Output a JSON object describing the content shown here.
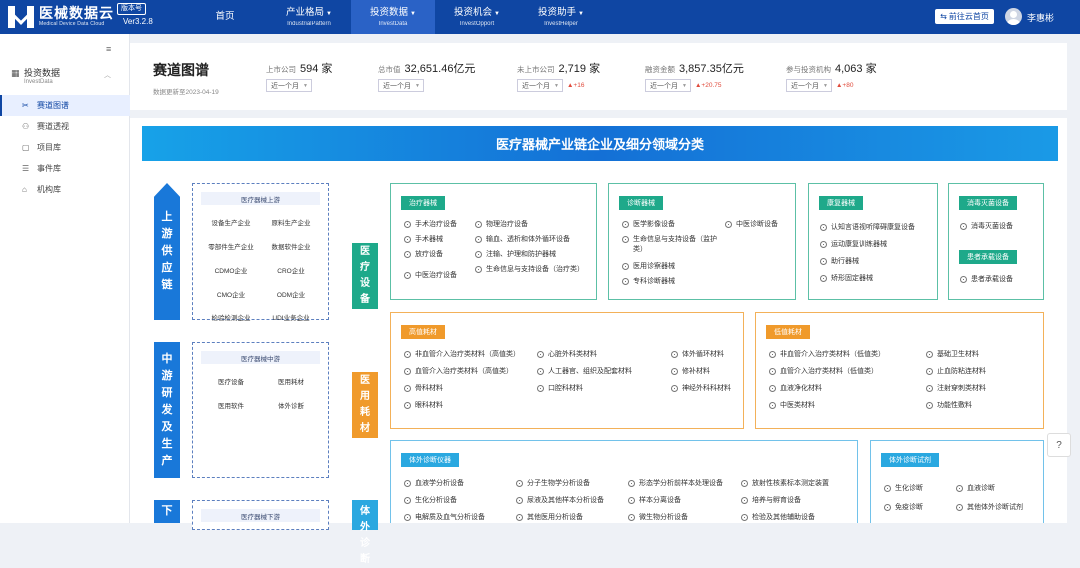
{
  "brand": {
    "name": "医械数据云",
    "sub": "Medical Device Data Cloud",
    "version_badge": "版本号",
    "version": "Ver3.2.8"
  },
  "nav": [
    {
      "label": "首页",
      "sub": ""
    },
    {
      "label": "产业格局",
      "sub": "IndustrialPattern"
    },
    {
      "label": "投资数据",
      "sub": "InvestData"
    },
    {
      "label": "投资机会",
      "sub": "InvestOpport"
    },
    {
      "label": "投资助手",
      "sub": "InvestHelper"
    }
  ],
  "header": {
    "goto_label": "前往云首页",
    "username": "李惠彬"
  },
  "sidebar": {
    "group": {
      "label": "投资数据",
      "sub": "InvestData"
    },
    "items": [
      {
        "label": "赛道图谱",
        "icon": "scissors-icon"
      },
      {
        "label": "赛道透视",
        "icon": "chart-icon"
      },
      {
        "label": "项目库",
        "icon": "file-icon"
      },
      {
        "label": "事件库",
        "icon": "event-icon"
      },
      {
        "label": "机构库",
        "icon": "building-icon"
      }
    ]
  },
  "stats": {
    "title": "赛道图谱",
    "update": "数据更新至2023-04-19",
    "items": [
      {
        "label": "上市公司",
        "value": "594 家",
        "period": "近一个月",
        "delta": ""
      },
      {
        "label": "总市值",
        "value": "32,651.46亿元",
        "period": "近一个月",
        "delta": ""
      },
      {
        "label": "未上市公司",
        "value": "2,719 家",
        "period": "近一个月",
        "delta": "▲+16"
      },
      {
        "label": "融资金额",
        "value": "3,857.35亿元",
        "period": "近一个月",
        "delta": "▲+20.75"
      },
      {
        "label": "参与投资机构",
        "value": "4,063 家",
        "period": "近一个月",
        "delta": "▲+80"
      }
    ]
  },
  "map": {
    "banner": "医疗器械产业链企业及细分领域分类",
    "chain": {
      "upstream": {
        "label": "上游供应链",
        "head": "医疗器械上游",
        "cells": [
          "设备生产企业",
          "原料生产企业",
          "零部件生产企业",
          "数据软件企业",
          "CDMO企业",
          "CRO企业",
          "CMO企业",
          "ODM企业",
          "检验检测企业",
          "UDI业务企业"
        ]
      },
      "midstream": {
        "label": "中游研发及生产",
        "head": "医疗器械中游",
        "cells": [
          "医疗设备",
          "医用耗材",
          "医用软件",
          "体外诊断"
        ]
      },
      "downstream": {
        "label": "下",
        "head": "医疗器械下游"
      }
    },
    "categories": {
      "equipment": "医疗设备",
      "consumables": "医用耗材",
      "ivd": "体外诊断"
    },
    "cards": {
      "treatment": {
        "tag": "治疗器械",
        "items": [
          "手术治疗设备",
          "手术器械",
          "放疗设备",
          "中医治疗设备",
          "物理治疗设备",
          "输血、透析和体外循环设备",
          "注输、护理和防护器械",
          "生命信息与支持设备（治疗类）"
        ]
      },
      "diagnosis": {
        "tag": "诊断器械",
        "items": [
          "医学影像设备",
          "生命信息与支持设备（监护类）",
          "医用诊察器械",
          "专科诊断器械",
          "中医诊断设备"
        ]
      },
      "rehab": {
        "tag": "康复器械",
        "items": [
          "认知言语视听障碍康复设备",
          "运动康复训练器械",
          "助行器械",
          "矫形固定器械"
        ]
      },
      "disinfect": {
        "tag": "消毒灭菌设备",
        "items": [
          "消毒灭菌设备"
        ]
      },
      "patient": {
        "tag": "患者承载设备",
        "items": [
          "患者承载设备"
        ]
      },
      "highvalue": {
        "tag": "高值耗材",
        "items": [
          "非血管介入治疗类材料（高值类）",
          "血管介入治疗类材料（高值类）",
          "骨科材料",
          "眼科材料",
          "心脏外科类材料",
          "人工器官、组织及配套材料",
          "口腔科材料",
          "体外循环材料",
          "修补材料",
          "神经外科科材料"
        ]
      },
      "lowvalue": {
        "tag": "低值耗材",
        "items": [
          "非血管介入治疗类材料（低值类）",
          "血管介入治疗类材料（低值类）",
          "血液净化材料",
          "中医类材料",
          "基础卫生材料",
          "止血防粘连材料",
          "注射穿刺类材料",
          "功能性敷料"
        ]
      },
      "ivdinst": {
        "tag": "体外诊断仪器",
        "items": [
          "血液学分析设备",
          "生化分析设备",
          "电解质及血气分析设备",
          "分子生物学分析设备",
          "尿液及其他样本分析设备",
          "其他医用分析设备",
          "形态学分析前样本处理设备",
          "样本分离设备",
          "微生物分析设备",
          "放射性核素标本测定装置",
          "培养与孵育设备",
          "检验及其他辅助设备"
        ]
      },
      "ivdreag": {
        "tag": "体外诊断试剂",
        "items": [
          "生化诊断",
          "免疫诊断",
          "血液诊断",
          "其他体外诊断试剂"
        ]
      }
    }
  },
  "help_label": "?"
}
